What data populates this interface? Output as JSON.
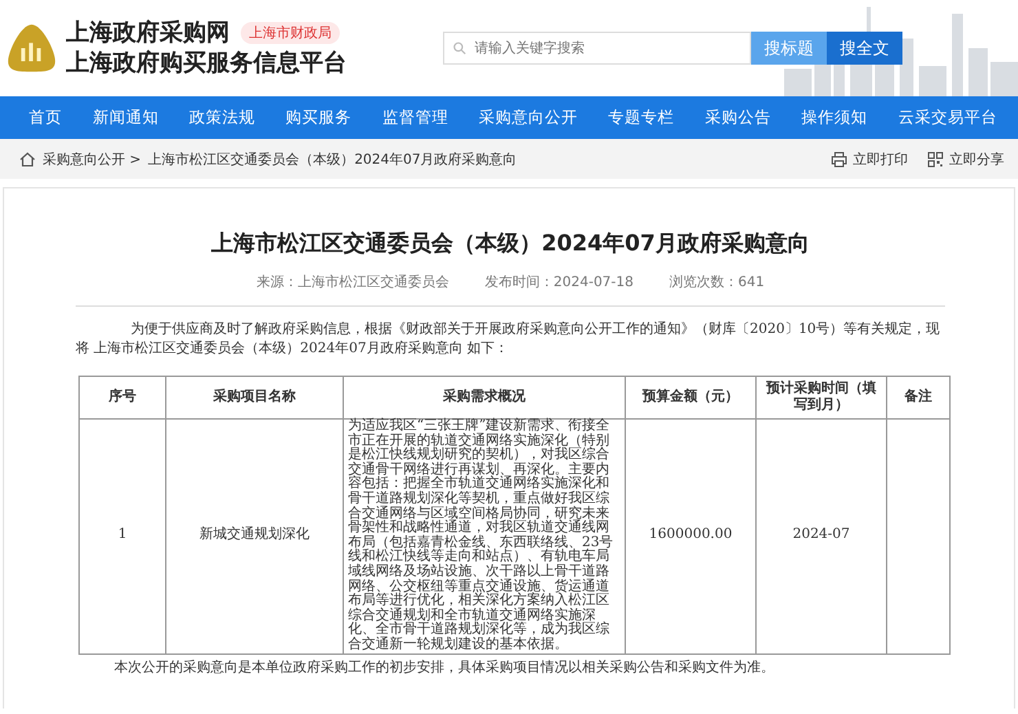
{
  "site": {
    "title": "上海政府采购网",
    "badge": "上海市财政局",
    "subtitle": "上海政府购买服务信息平台"
  },
  "search": {
    "placeholder": "请输入关键字搜索",
    "buttons": [
      {
        "label": "搜标题",
        "selected": false
      },
      {
        "label": "搜全文",
        "selected": true
      }
    ]
  },
  "nav": [
    "首页",
    "新闻通知",
    "政策法规",
    "购买服务",
    "监督管理",
    "采购意向公开",
    "专题专栏",
    "采购公告",
    "操作须知",
    "云采交易平台"
  ],
  "breadcrumb": {
    "items": [
      "采购意向公开 >",
      "上海市松江区交通委员会（本级）2024年07月政府采购意向"
    ],
    "actions": [
      {
        "kind": "print",
        "label": "立即打印"
      },
      {
        "kind": "share",
        "label": "立即分享"
      }
    ]
  },
  "article": {
    "title": "上海市松江区交通委员会（本级）2024年07月政府采购意向",
    "meta": [
      "来源：上海市松江区交通委员会",
      "发布时间：2024-07-18",
      "浏览次数：641"
    ],
    "intro": "为便于供应商及时了解政府采购信息，根据《财政部关于开展政府采购意向公开工作的通知》（财库〔2020〕10号）等有关规定，现将 上海市松江区交通委员会（本级）2024年07月政府采购意向 如下：",
    "table": {
      "columns": [
        "序号",
        "采购项目名称",
        "采购需求概况",
        "预算金额（元）",
        "预计采购时间（填写到月）",
        "备注"
      ],
      "rows": [
        [
          "1",
          "新城交通规划深化",
          "为适应我区“三张王牌”建设新需求、衔接全市正在开展的轨道交通网络实施深化（特别是松江快线规划研究的契机），对我区综合交通骨干网络进行再谋划、再深化。主要内容包括：把握全市轨道交通网络实施深化和骨干道路规划深化等契机，重点做好我区综合交通网络与区域空间格局协同，研究未来骨架性和战略性通道，对我区轨道交通线网布局（包括嘉青松金线、东西联络线、23号线和松江快线等走向和站点）、有轨电车局域线网络及场站设施、次干路以上骨干道路网络、公交枢纽等重点交通设施、货运通道布局等进行优化，相关深化方案纳入松江区综合交通规划和全市轨道交通网络实施深化、全市骨干道路规划深化等，成为我区综合交通新一轮规划建设的基本依据。",
          "1600000.00",
          "2024-07",
          ""
        ]
      ]
    },
    "footnote": "本次公开的采购意向是本单位政府采购工作的初步安排，具体采购项目情况以相关采购公告和采购文件为准。"
  }
}
